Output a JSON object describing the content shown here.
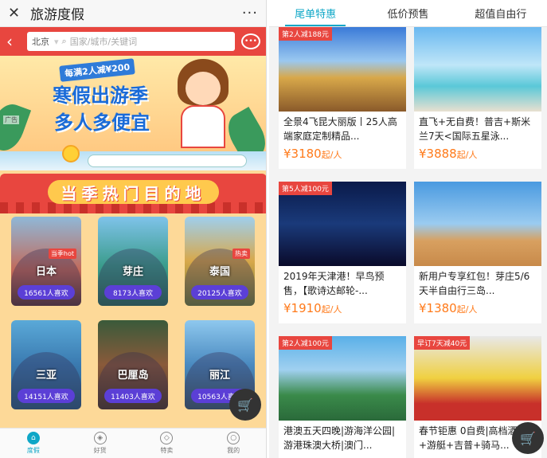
{
  "left": {
    "header": {
      "close_icon": "close-icon",
      "title": "旅游度假",
      "more_icon": "more-icon",
      "more_glyph": "···"
    },
    "search": {
      "city": "北京",
      "placeholder": "国家/城市/关键词"
    },
    "banner": {
      "promo_top": "每满2人减¥200",
      "promo_main": "寒假出游季",
      "promo_sub": "多人多便宜",
      "ad_label": "广告"
    },
    "hot_title": "当季热门目的地",
    "destinations": [
      {
        "name": "日本",
        "likes": "16561人喜欢",
        "badge": "当季hot"
      },
      {
        "name": "芽庄",
        "likes": "8173人喜欢",
        "badge": ""
      },
      {
        "name": "泰国",
        "likes": "20125人喜欢",
        "badge": "热卖"
      },
      {
        "name": "三亚",
        "likes": "14151人喜欢",
        "badge": ""
      },
      {
        "name": "巴厘岛",
        "likes": "11403人喜欢",
        "badge": ""
      },
      {
        "name": "丽江",
        "likes": "10563人喜欢",
        "badge": ""
      }
    ],
    "nav": [
      {
        "label": "度假",
        "icon": "palm-tree-icon",
        "active": true
      },
      {
        "label": "好货",
        "icon": "compass-icon",
        "active": false
      },
      {
        "label": "特卖",
        "icon": "tag-icon",
        "active": false
      },
      {
        "label": "我的",
        "icon": "user-icon",
        "active": false
      }
    ]
  },
  "right": {
    "tabs": [
      "尾单特惠",
      "低价预售",
      "超值自由行"
    ],
    "cards": [
      {
        "tag": "第2人减188元",
        "title": "全景4飞昆大丽版丨25人高端家庭定制精品...",
        "price": "¥3180",
        "unit": "起/人"
      },
      {
        "tag": "",
        "title": "直飞+无自费！普吉+斯米兰7天<国际五星泳...",
        "price": "¥3888",
        "unit": "起/人"
      },
      {
        "tag": "第5人减100元",
        "title": "2019年天津港！早鸟预售，【歌诗达邮轮-...",
        "price": "¥1910",
        "unit": "起/人"
      },
      {
        "tag": "",
        "title": "新用户专享红包！芽庄5/6天半自由行三岛...",
        "price": "¥1380",
        "unit": "起/人"
      },
      {
        "tag": "第2人减100元",
        "title": "港澳五天四晚|游海洋公园|游港珠澳大桥|澳门...",
        "price": "",
        "unit": ""
      },
      {
        "tag": "早订7天减40元",
        "title": "春节钜惠 0自费|高档酒店+游艇+吉普+骑马...",
        "price": "",
        "unit": ""
      }
    ]
  },
  "colors": {
    "accent": "#0fa7c7",
    "red": "#e8463f",
    "price": "#ff7a1a",
    "badge_purple": "#5b3fd6"
  }
}
